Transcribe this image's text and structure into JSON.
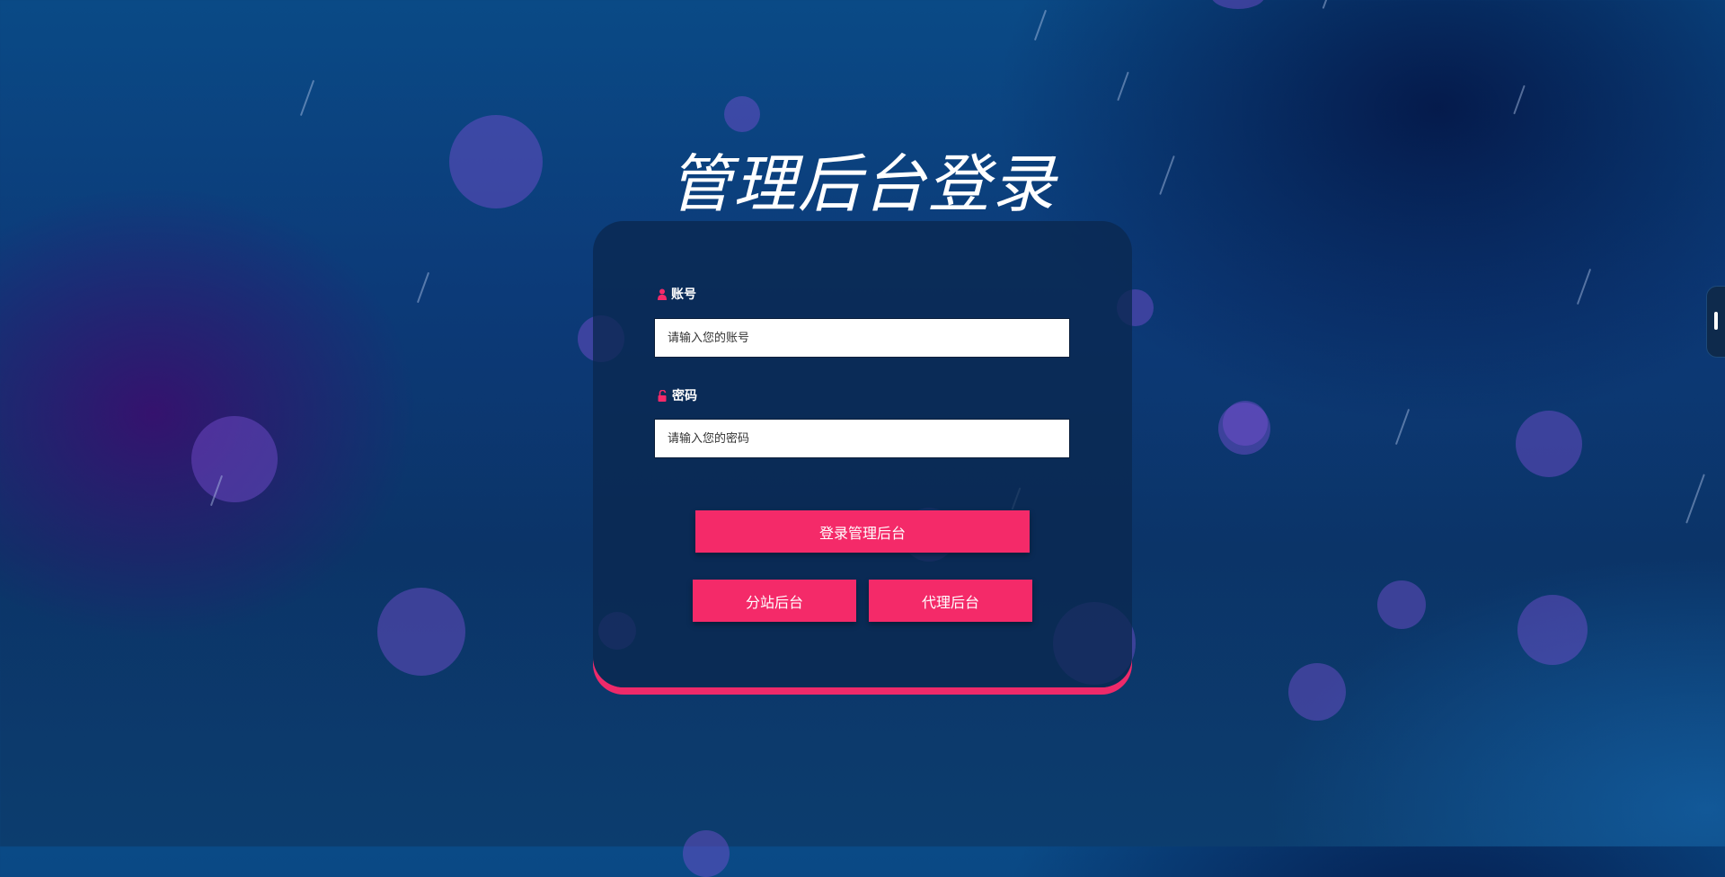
{
  "page": {
    "title": "管理后台登录"
  },
  "login_form": {
    "account_label": "账号",
    "account_placeholder": "请输入您的账号",
    "account_value": "",
    "password_label": "密码",
    "password_placeholder": "请输入您的密码",
    "password_value": "",
    "login_button": "登录管理后台",
    "branch_button": "分站后台",
    "agent_button": "代理后台"
  },
  "icons": {
    "account": "user-icon",
    "password": "unlock-icon"
  },
  "colors": {
    "accent": "#f42a69",
    "card_border": "#ee2a6a",
    "card_bg": "#0a2850"
  }
}
